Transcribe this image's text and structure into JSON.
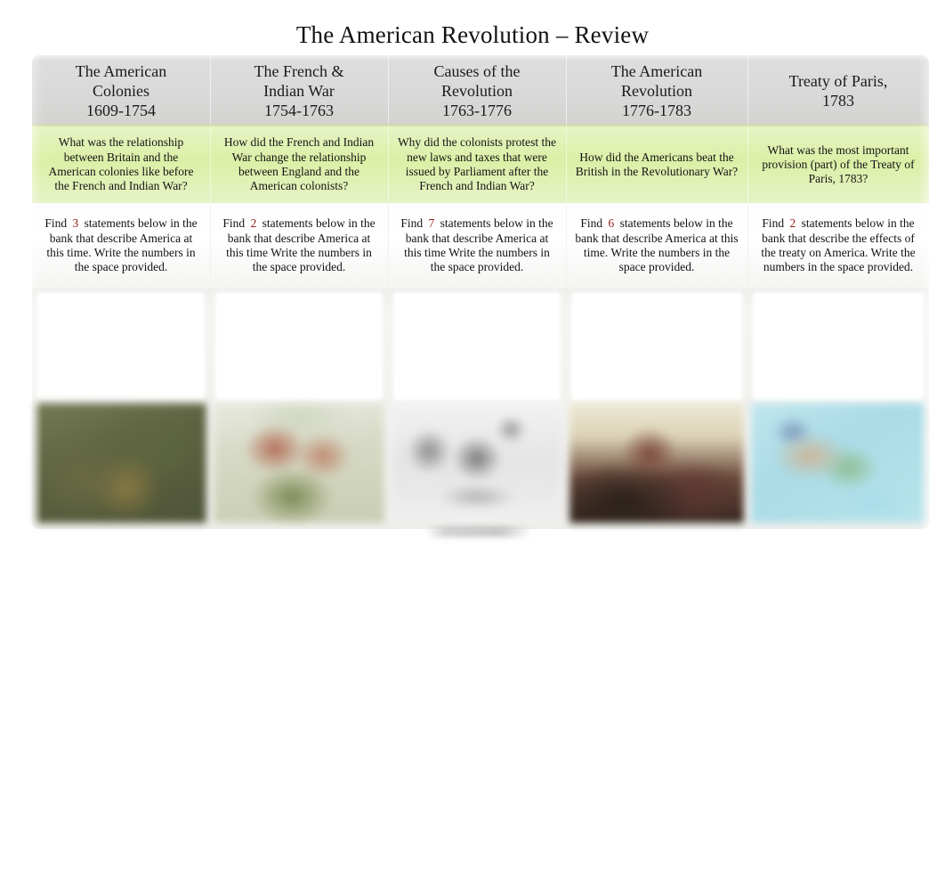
{
  "title": "The American Revolution – Review",
  "accents": {
    "count_color": "#8f1d15",
    "header_bg": "#d9d9d9",
    "question_bg": "#dcefa6",
    "page_bg": "#ffffff"
  },
  "columns": [
    {
      "header_lines": [
        "The American",
        "Colonies",
        "1609-1754"
      ],
      "question": "What was the relationship between Britain and the American colonies like before the French and Indian War?",
      "find": {
        "prefix": "Find",
        "count": "3",
        "rest": "statements below in the bank that describe America at this time. Write the numbers in the space provided."
      },
      "answer_value": "",
      "image_name": "colonial-america-painting"
    },
    {
      "header_lines": [
        "The French &",
        "Indian War",
        "1754-1763"
      ],
      "question": "How did the French and Indian War change the relationship between England and the American colonists?",
      "find": {
        "prefix": "Find",
        "count": "2",
        "rest": "statements below in the bank that describe America at this time Write the numbers in the space provided."
      },
      "answer_value": "",
      "image_name": "french-and-indian-war-painting"
    },
    {
      "header_lines": [
        "Causes of the",
        "Revolution",
        "1763-1776"
      ],
      "question": "Why did the colonists protest the new laws and taxes that were issued by Parliament after the French and Indian War?",
      "find": {
        "prefix": "Find",
        "count": "7",
        "rest": "statements below in the bank that describe America at this time Write the numbers in the space provided."
      },
      "answer_value": "",
      "image_name": "boston-tea-party-engraving"
    },
    {
      "header_lines": [
        "The American",
        "Revolution",
        "1776-1783"
      ],
      "question": "How did the Americans beat the British in the Revolutionary War?",
      "find": {
        "prefix": "Find",
        "count": "6",
        "rest": "statements below in the bank that describe America at this time. Write the numbers in the space provided."
      },
      "answer_value": "",
      "image_name": "revolutionary-war-battle-painting"
    },
    {
      "header_lines": [
        "Treaty of Paris,",
        "1783"
      ],
      "question": "What was the most important provision (part) of the Treaty of Paris, 1783?",
      "find": {
        "prefix": "Find",
        "count": "2",
        "rest": "statements below in the bank that describe the effects of the treaty on America. Write the numbers in the space provided."
      },
      "answer_value": "",
      "image_name": "north-america-1783-map"
    }
  ]
}
